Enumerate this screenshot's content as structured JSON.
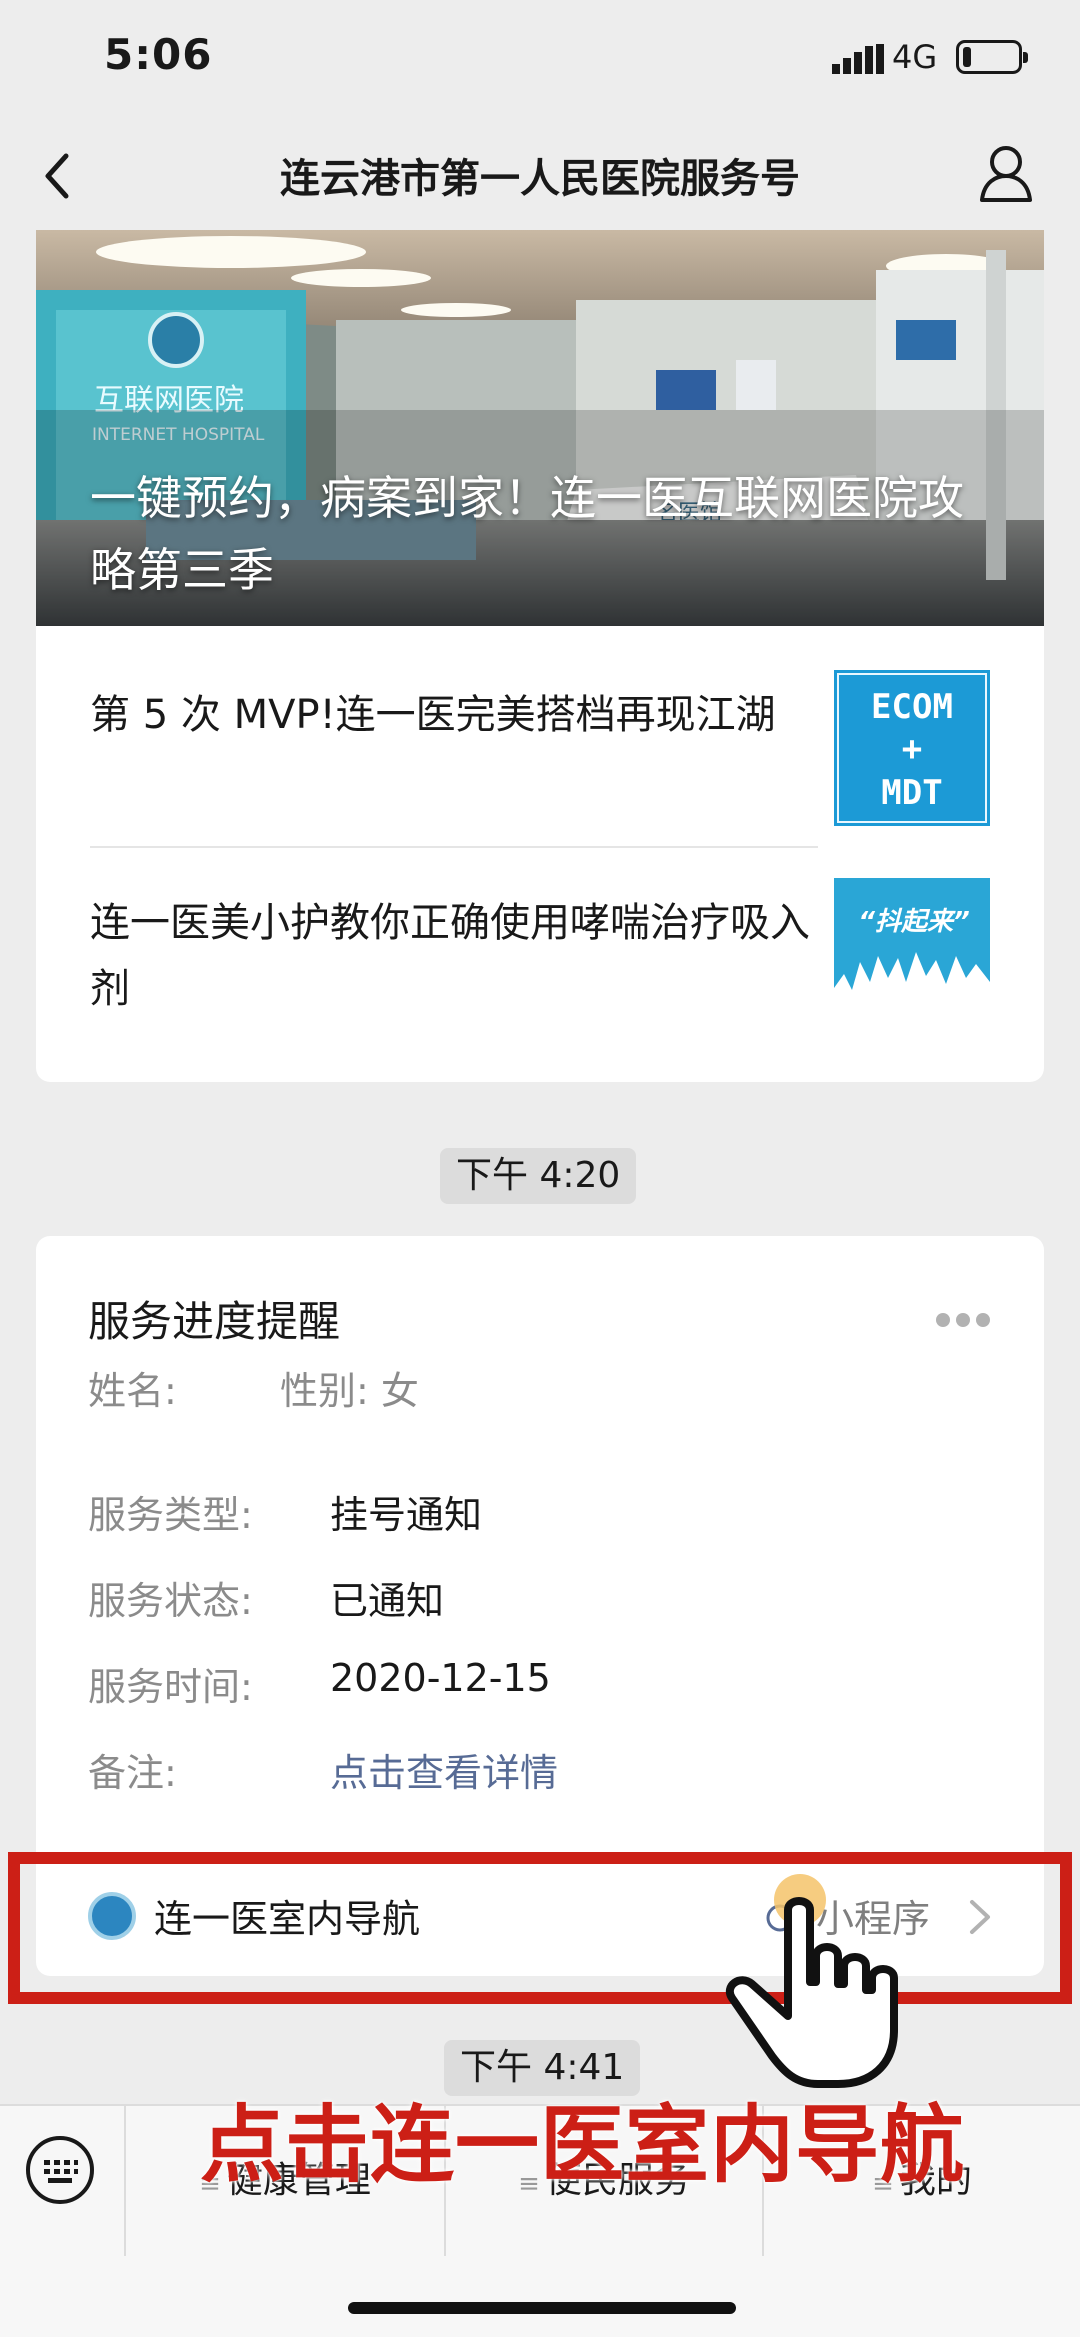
{
  "status_bar": {
    "time": "5:06",
    "network": "4G",
    "battery_level": 0.15
  },
  "nav": {
    "title": "连云港市第一人民医院服务号"
  },
  "articles": {
    "banner": {
      "title": "一键预约，病案到家！连一医互联网医院攻略第三季",
      "sign_cn": "互联网医院",
      "sign_en": "INTERNET HOSPITAL",
      "desk_sign": "名医馆"
    },
    "items": [
      {
        "title": "第 5 次 MVP!连一医完美搭档再现江湖",
        "thumb_text_1": "ECOM",
        "thumb_text_2": "+",
        "thumb_text_3": "MDT"
      },
      {
        "title": "连一医美小护教你正确使用哮喘治疗吸入剂",
        "thumb_text": "“抖起来”"
      }
    ]
  },
  "timestamps": [
    "下午 4:20",
    "下午 4:41"
  ],
  "service_card": {
    "title": "服务进度提醒",
    "name_label": "姓名:",
    "gender": "性别: 女",
    "fields": [
      {
        "label": "服务类型:",
        "value": "挂号通知"
      },
      {
        "label": "服务状态:",
        "value": "已通知"
      },
      {
        "label": "服务时间:",
        "value": "2020-12-15"
      },
      {
        "label": "备注:",
        "value": "点击查看详情"
      }
    ],
    "mini_program": {
      "name": "连一医室内导航",
      "tag": "小程序"
    }
  },
  "instruction": "点击连一医室内导航",
  "bottom_menu": {
    "items": [
      "健康管理",
      "便民服务",
      "我的"
    ]
  },
  "colors": {
    "accent_red": "#cc1f16",
    "link_blue": "#576b95",
    "thumb_blue": "#1c9ad6"
  }
}
